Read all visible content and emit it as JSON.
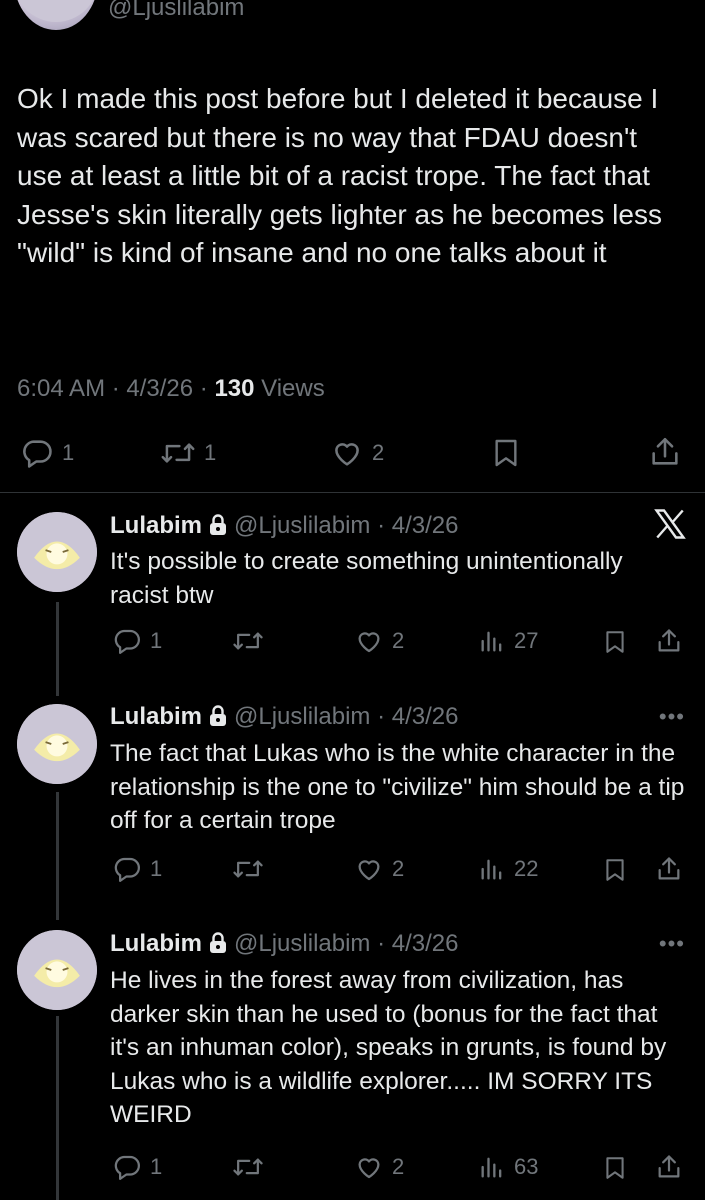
{
  "top_post": {
    "handle": "@Ljuslilabim",
    "text": "Ok I made this post before but I deleted it because I was scared but there is no way that FDAU doesn't use at least a little bit of a racist trope. The fact that Jesse's skin literally gets lighter as he becomes less \"wild\" is kind of insane and no one talks about it",
    "time_date": "6:04 AM · 4/3/26 · ",
    "views_count": "130",
    "views_label": " Views",
    "actions": {
      "replies": "1",
      "reposts": "1",
      "likes": "2"
    }
  },
  "replies": [
    {
      "name": "Lulabim",
      "handle_date": "@Ljuslilabim · 4/3/26",
      "text": "It's possible to create something unintentionally racist btw",
      "replies": "1",
      "likes": "2",
      "views": "27"
    },
    {
      "name": "Lulabim",
      "handle_date": "@Ljuslilabim · 4/3/26",
      "text": "The fact that Lukas who is the white character in the relationship is the one to \"civilize\" him should be a tip off for a certain trope",
      "replies": "1",
      "likes": "2",
      "views": "22"
    },
    {
      "name": "Lulabim",
      "handle_date": "@Ljuslilabim · 4/3/26",
      "text": "He lives in the forest away from civilization, has darker skin than he used to (bonus for the fact that it's an inhuman color), speaks in grunts, is found by Lukas who is a wildlife explorer..... IM SORRY ITS WEIRD",
      "replies": "1",
      "likes": "2",
      "views": "63"
    }
  ],
  "icons": {
    "reply": "reply-icon",
    "repost": "repost-icon",
    "like": "heart-icon",
    "views": "views-icon",
    "bookmark": "bookmark-icon",
    "share": "share-icon",
    "lock": "lock-icon",
    "more": "more-icon",
    "x": "x-logo-icon"
  },
  "colors": {
    "background": "#000000",
    "text": "#e7e9ea",
    "secondary": "#71767b",
    "divider": "#2f3336"
  }
}
